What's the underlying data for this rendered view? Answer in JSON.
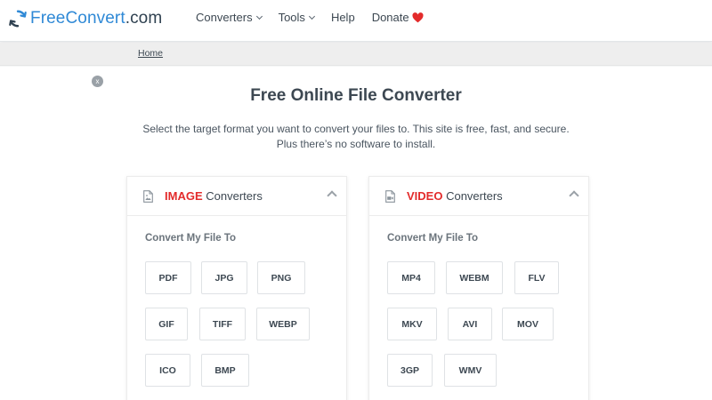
{
  "header": {
    "logo": {
      "free": "Free",
      "convert": "Convert",
      "domain": ".com"
    },
    "nav": [
      {
        "label": "Converters",
        "has_dropdown": true
      },
      {
        "label": "Tools",
        "has_dropdown": true
      },
      {
        "label": "Help",
        "has_dropdown": false
      },
      {
        "label": "Donate",
        "has_dropdown": false,
        "icon": "heart-icon"
      }
    ]
  },
  "breadcrumb": {
    "home": "Home"
  },
  "close_label": "x",
  "hero": {
    "title": "Free Online File Converter",
    "subtitle_line1": "Select the target format you want to convert your files to. This site is free, fast, and secure.",
    "subtitle_line2": "Plus there’s no software to install."
  },
  "cards": {
    "image": {
      "keyword": "IMAGE",
      "title_rest": " Converters",
      "subheading": "Convert My File To",
      "icon": "image-file-icon",
      "formats": [
        "PDF",
        "JPG",
        "PNG",
        "GIF",
        "TIFF",
        "WEBP",
        "ICO",
        "BMP"
      ]
    },
    "video": {
      "keyword": "VIDEO",
      "title_rest": " Converters",
      "subheading": "Convert My File To",
      "icon": "video-file-icon",
      "formats": [
        "MP4",
        "WEBM",
        "FLV",
        "MKV",
        "AVI",
        "MOV",
        "3GP",
        "WMV"
      ]
    }
  },
  "colors": {
    "brand_blue": "#2f89d6",
    "accent_red": "#e32b2b",
    "text": "#3d4852"
  }
}
